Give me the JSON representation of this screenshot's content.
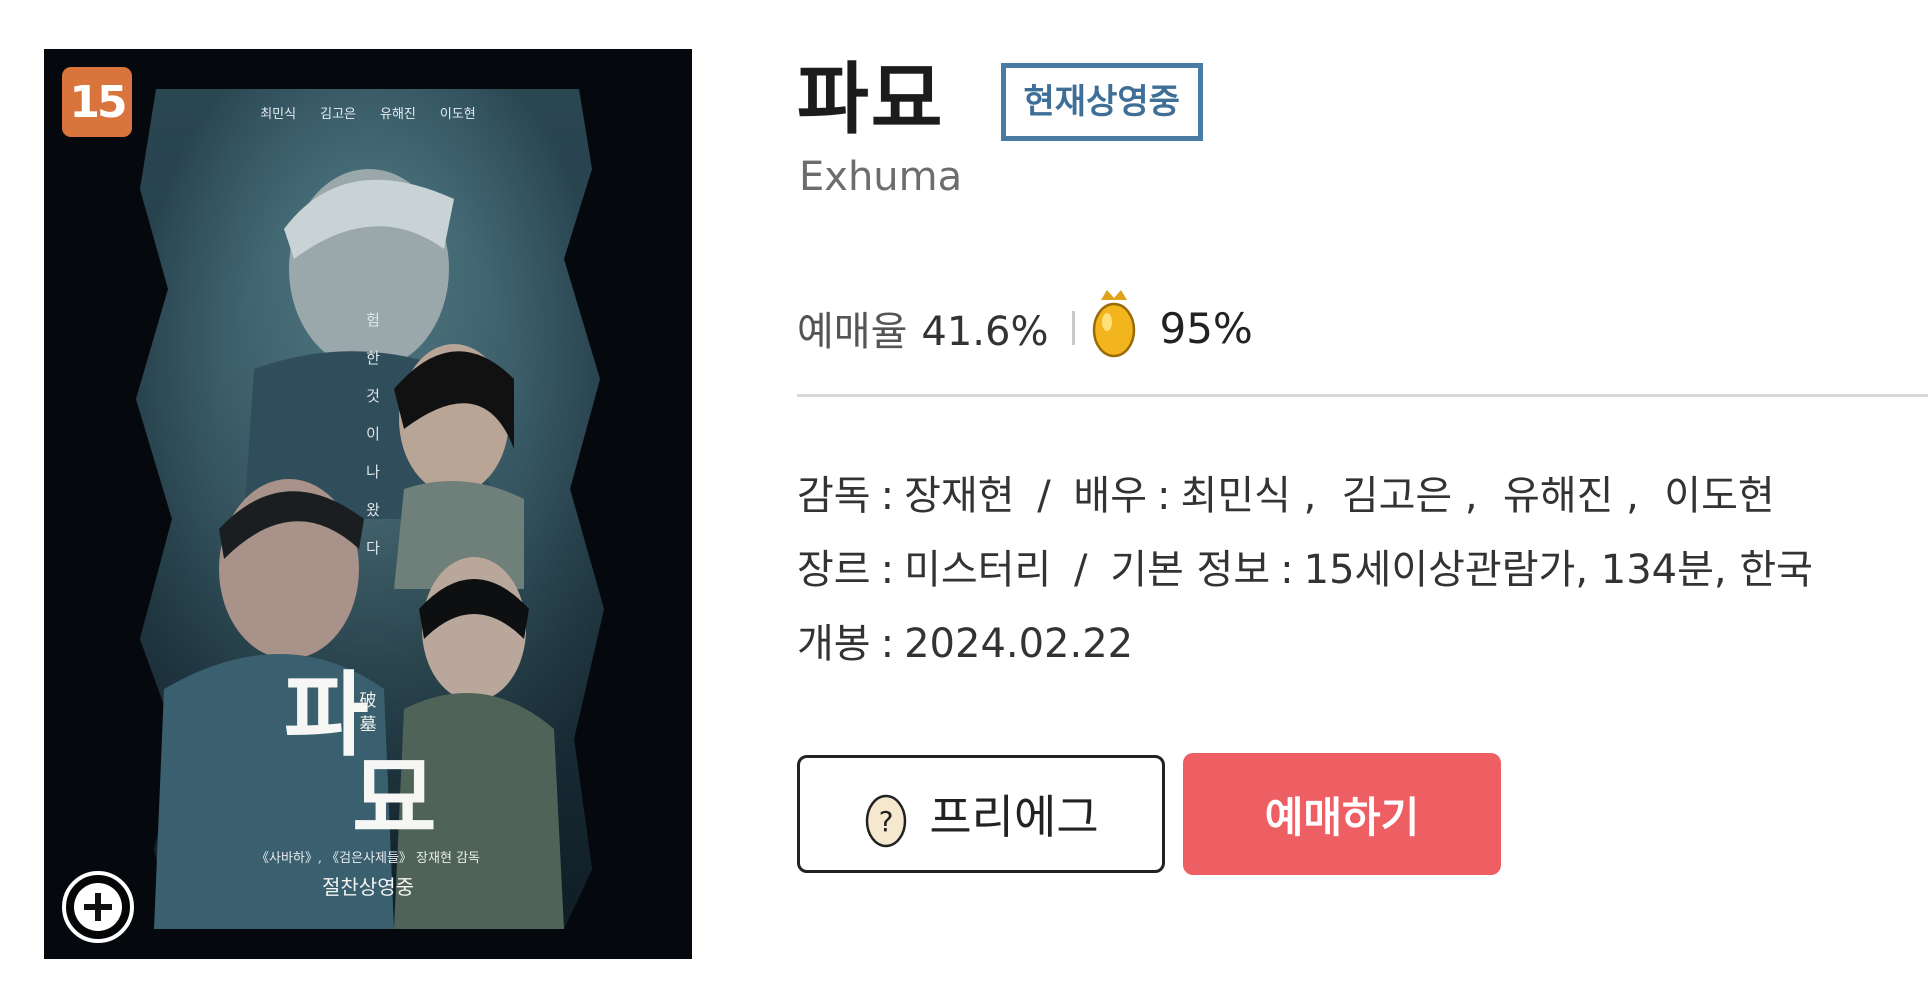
{
  "poster": {
    "age_rating": "15",
    "cast": [
      "최민식",
      "김고은",
      "유해진",
      "이도현"
    ],
    "tagline": [
      "험",
      "한",
      "것",
      "이",
      "나",
      "왔",
      "다"
    ],
    "hanja": [
      "破",
      "墓"
    ],
    "title_chars": [
      "파",
      "묘"
    ],
    "credit": "《사바하》, 《검은사제들》 장재현 감독",
    "now_showing": "절찬상영중",
    "zoom_icon": "plus-circle-icon"
  },
  "movie": {
    "title": "파묘",
    "status_badge": "현재상영중",
    "english_title": "Exhuma"
  },
  "stats": {
    "booking_rate_label": "예매율",
    "booking_rate_value": "41.6%",
    "egg_icon": "golden-egg-icon",
    "egg_score": "95%"
  },
  "info": {
    "director_label": "감독",
    "director": "장재현",
    "actors_label": "배우",
    "actors": "최민식 ,  김고은 ,  유해진 ,  이도현",
    "genre_label": "장르",
    "genre": "미스터리",
    "basic_label": "기본 정보",
    "basic": "15세이상관람가, 134분, 한국",
    "release_label": "개봉",
    "release": "2024.02.22"
  },
  "buttons": {
    "preegg_label": "프리에그",
    "preegg_icon": "question-egg-icon",
    "book_label": "예매하기"
  },
  "colors": {
    "badge_border": "#4a7ba3",
    "book_button": "#ee5f64",
    "age_badge": "#d9743c"
  }
}
